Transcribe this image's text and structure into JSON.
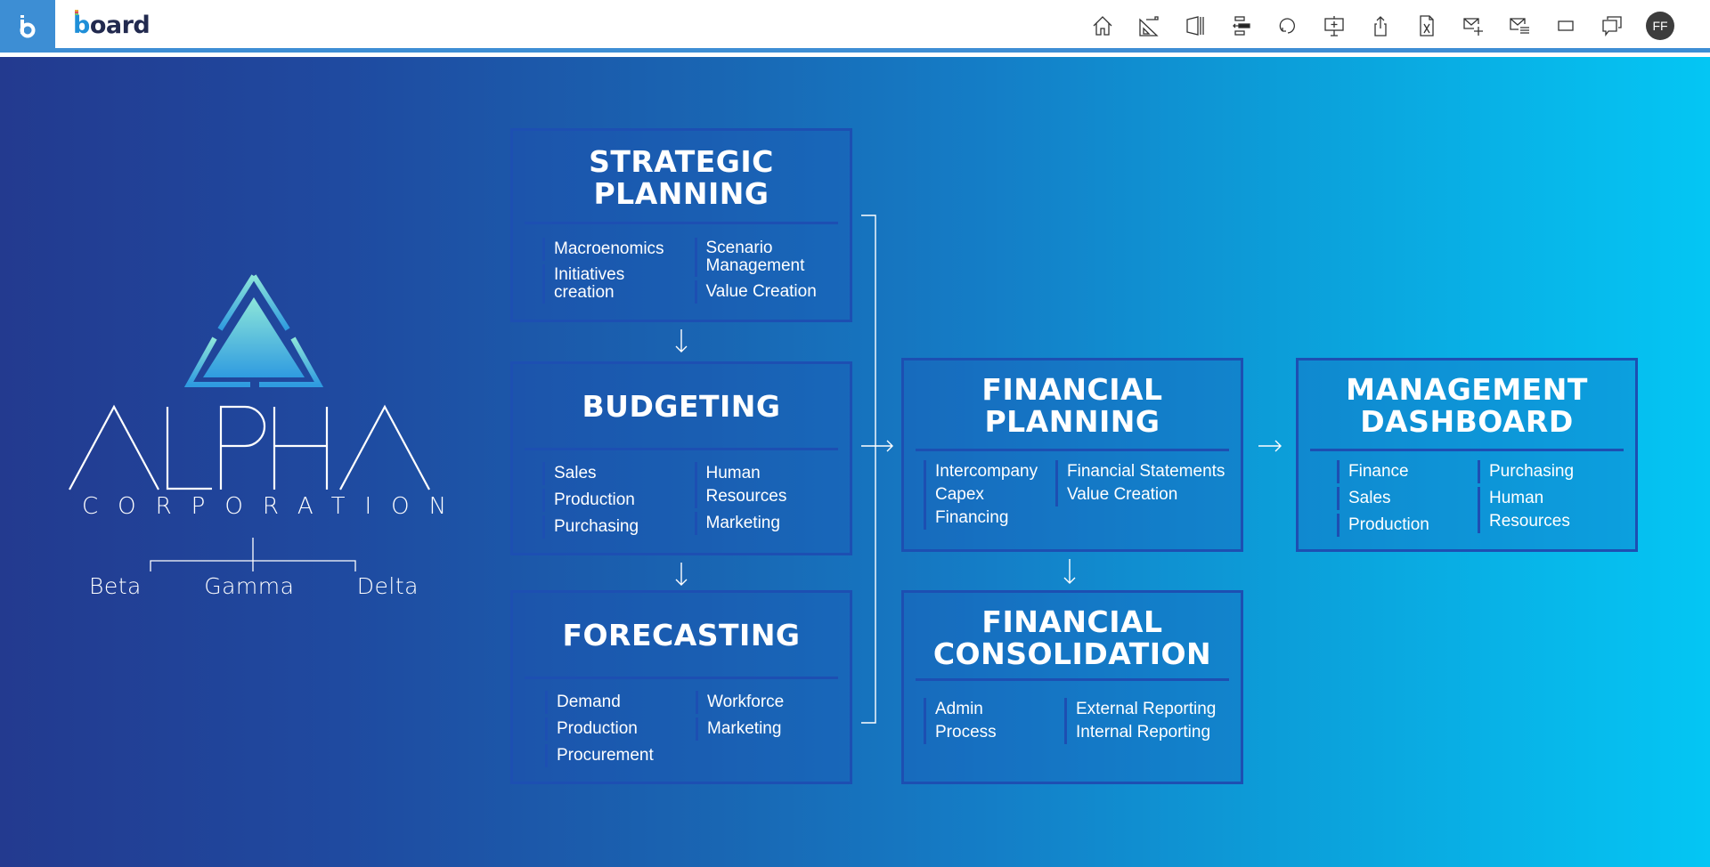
{
  "header": {
    "brand_letter": "b",
    "logo_text": "board",
    "toolbar": [
      {
        "icon": "home-icon",
        "label": "Home"
      },
      {
        "icon": "design-mode-icon",
        "label": "Design mode"
      },
      {
        "icon": "presentation-panel-icon",
        "label": "Panel"
      },
      {
        "icon": "align-icon",
        "label": "Align"
      },
      {
        "icon": "refresh-icon",
        "label": "Refresh"
      },
      {
        "icon": "add-presentation-icon",
        "label": "Add to presentation"
      },
      {
        "icon": "share-icon",
        "label": "Share"
      },
      {
        "icon": "excel-export-icon",
        "label": "Export to Excel"
      },
      {
        "icon": "new-mail-icon",
        "label": "New mail"
      },
      {
        "icon": "mail-list-icon",
        "label": "Mail list"
      },
      {
        "icon": "fullscreen-icon",
        "label": "Full screen"
      },
      {
        "icon": "comments-icon",
        "label": "Comments"
      }
    ],
    "user_initials": "FF"
  },
  "company": {
    "name": "ALPHA",
    "subtitle": "CORPORATION",
    "subsidiaries": [
      "Beta",
      "Gamma",
      "Delta"
    ]
  },
  "boxes": {
    "strategic": {
      "title": "STRATEGIC\nPLANNING",
      "col1": [
        "Macroenomics",
        "Initiatives\ncreation"
      ],
      "col2": [
        "Scenario\nManagement",
        "Value Creation"
      ]
    },
    "budgeting": {
      "title": "BUDGETING",
      "col1": [
        "Sales",
        "Production",
        "Purchasing"
      ],
      "col2": [
        "Human Resources",
        "Marketing"
      ]
    },
    "forecasting": {
      "title": "FORECASTING",
      "col1": [
        "Demand",
        "Production",
        "Procurement"
      ],
      "col2": [
        "Workforce",
        "Marketing"
      ]
    },
    "financial_planning": {
      "title": "FINANCIAL\nPLANNING",
      "col1": [
        "Intercompany",
        "Capex",
        "Financing"
      ],
      "col2": [
        "Financial Statements",
        "Value Creation"
      ]
    },
    "financial_consolidation": {
      "title": "FINANCIAL\nCONSOLIDATION",
      "col1": [
        "Admin",
        "Process"
      ],
      "col2": [
        "External Reporting",
        "Internal Reporting"
      ]
    },
    "management_dashboard": {
      "title": "MANAGEMENT\nDASHBOARD",
      "col1": [
        "Finance",
        "Sales",
        "Production"
      ],
      "col2": [
        "Purchasing",
        "Human Resources"
      ]
    }
  },
  "colors": {
    "header_accent": "#3d8ed4",
    "box_border": "#1d4fb2",
    "bg_start": "#233a8f",
    "bg_end": "#04c6f4"
  }
}
